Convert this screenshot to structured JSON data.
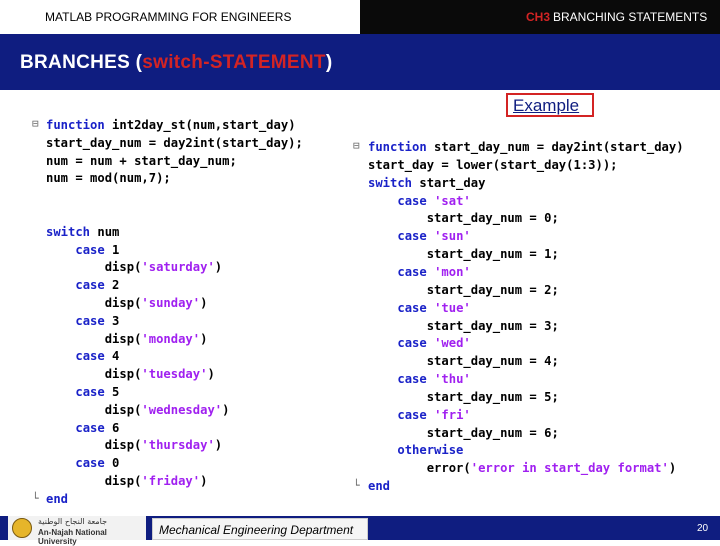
{
  "header": {
    "left_title": "MATLAB PROGRAMMING FOR ENGINEERS",
    "right_accent": "CH3",
    "right_title": "BRANCHING STATEMENTS"
  },
  "slide": {
    "title_main": "BRANCHES (",
    "title_red": "switch-STATEMENT",
    "title_end": ")",
    "example_label": "Example"
  },
  "left_code": [
    "function int2day_st(num,start_day)",
    "start_day_num = day2int(start_day);",
    "num = num + start_day_num;",
    "num = mod(num,7);",
    "",
    "",
    "switch num",
    "    case 1",
    "        disp('saturday')",
    "    case 2",
    "        disp('sunday')",
    "    case 3",
    "        disp('monday')",
    "    case 4",
    "        disp('tuesday')",
    "    case 5",
    "        disp('wednesday')",
    "    case 6",
    "        disp('thursday')",
    "    case 0",
    "        disp('friday')",
    "end"
  ],
  "right_code": [
    "function start_day_num = day2int(start_day)",
    "start_day = lower(start_day(1:3));",
    "switch start_day",
    "    case 'sat'",
    "        start_day_num = 0;",
    "    case 'sun'",
    "        start_day_num = 1;",
    "    case 'mon'",
    "        start_day_num = 2;",
    "    case 'tue'",
    "        start_day_num = 3;",
    "    case 'wed'",
    "        start_day_num = 4;",
    "    case 'thu'",
    "        start_day_num = 5;",
    "    case 'fri'",
    "        start_day_num = 6;",
    "    otherwise",
    "        error('error in start_day format')",
    "end"
  ],
  "footer": {
    "logo_arabic": "جامعة النجاح الوطنية",
    "logo_english": "An-Najah National University",
    "department": "Mechanical Engineering Department",
    "page_number": "20"
  },
  "colors": {
    "title_bar": "#0f1d80",
    "keyword": "#1a22c8",
    "string": "#a020f0",
    "accent_red": "#d32424"
  }
}
